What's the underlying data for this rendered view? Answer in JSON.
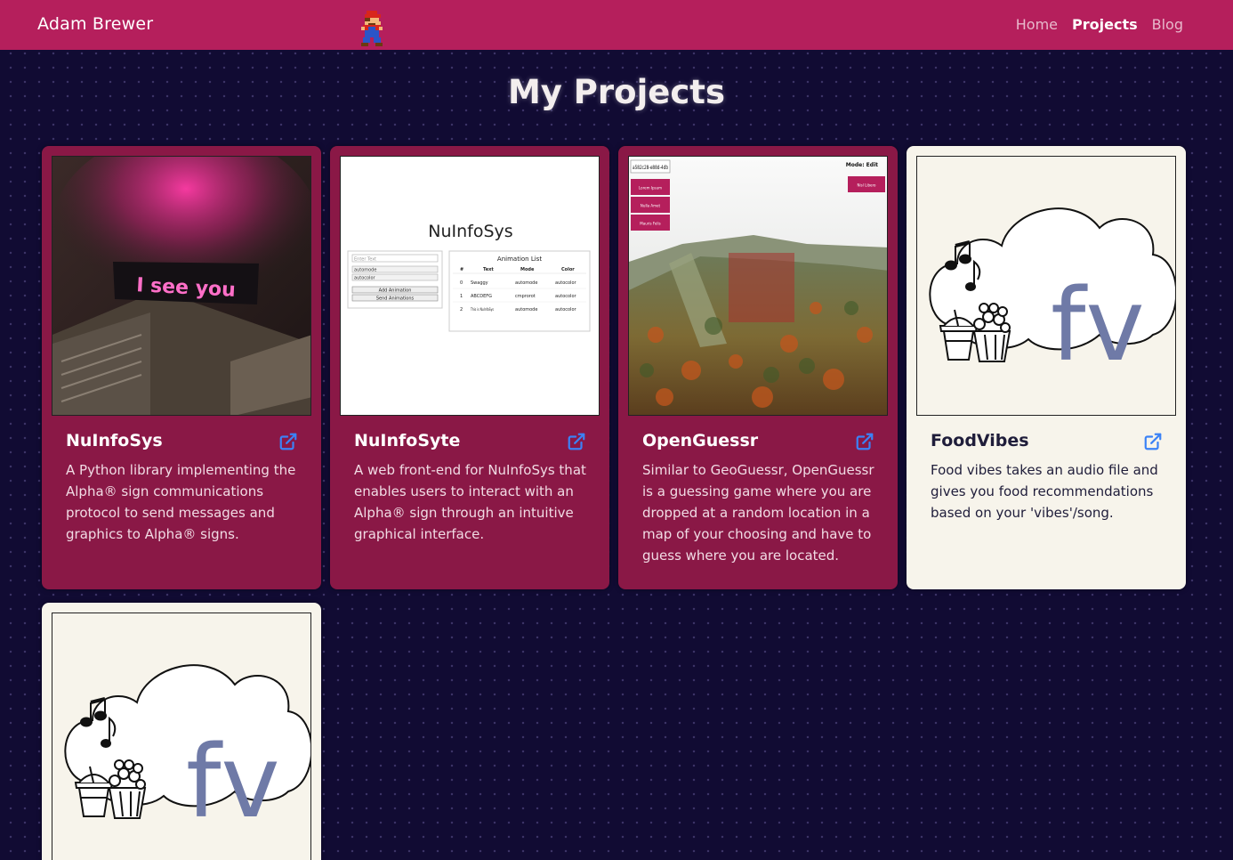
{
  "nav": {
    "brand": "Adam Brewer",
    "links": [
      {
        "label": "Home",
        "active": false
      },
      {
        "label": "Projects",
        "active": true
      },
      {
        "label": "Blog",
        "active": false
      }
    ]
  },
  "page": {
    "title": "My Projects"
  },
  "colors": {
    "navbar": "#b51f5c",
    "background": "#110b33",
    "card_dark": "#8a1846",
    "card_light": "#f7f4eb",
    "link_icon": "#3b82f6"
  },
  "projects": [
    {
      "title": "NuInfoSys",
      "description": "A Python library implementing the Alpha® sign communications protocol to send messages and graphics to Alpha® signs.",
      "thumb": {
        "sign_text": "I see you"
      },
      "link_icon": "external-link-icon"
    },
    {
      "title": "NuInfoSyte",
      "description": "A web front-end for NuInfoSys that enables users to interact with an Alpha® sign through an intuitive graphical interface.",
      "thumb": {
        "heading": "NuInfoSys",
        "input_placeholder": "Enter Text",
        "select_mode": "automode",
        "select_color": "autocolor",
        "add_button": "Add Animation",
        "send_button": "Send Animations",
        "list_title": "Animation List",
        "columns": [
          "#",
          "Text",
          "Mode",
          "Color"
        ],
        "rows": [
          [
            "0",
            "Swaggy",
            "automode",
            "autocolor"
          ],
          [
            "1",
            "ABCDEFG",
            "cmprorot",
            "autocolor"
          ],
          [
            "2",
            "This is NuInfoSys",
            "automode",
            "autocolor"
          ]
        ]
      },
      "link_icon": "external-link-icon"
    },
    {
      "title": "OpenGuessr",
      "description": "Similar to GeoGuessr, OpenGuessr is a guessing game where you are dropped at a random location in a map of your choosing and have to guess where you are located.",
      "thumb": {
        "id_text": "a582c28-e88d-4db",
        "mode_text": "Mode: Edit",
        "side_buttons": [
          "Lorem Ipsum",
          "Nulla Amet",
          "Mauris Felis"
        ],
        "action_button": "Nisl Libero"
      },
      "link_icon": "external-link-icon"
    },
    {
      "title": "FoodVibes",
      "description": "Food vibes takes an audio file and gives you food recommendations based on your 'vibes'/song.",
      "thumb": {
        "logo_text": "fv"
      },
      "link_icon": "external-link-icon"
    },
    {
      "thumb": {
        "logo_text": "fv"
      }
    }
  ]
}
